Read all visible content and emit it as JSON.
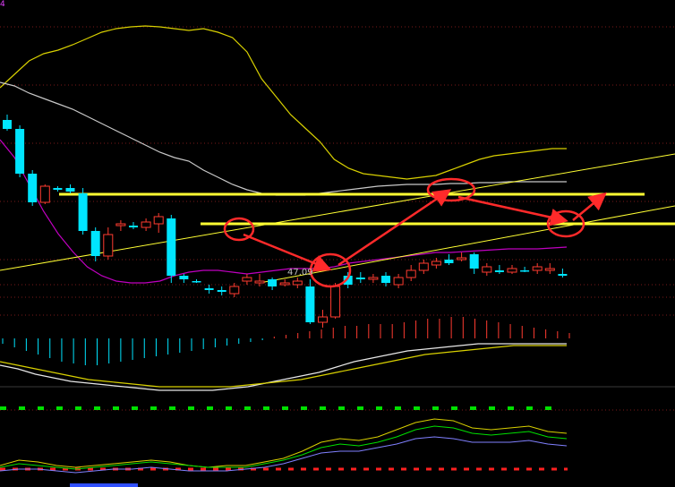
{
  "top_left_tag": "4",
  "colors": {
    "background": "#000000",
    "grid": "#7a1a1a",
    "bull": "#ff3b30",
    "bear": "#00e5ff",
    "upper_band": "#d8d000",
    "mid_band": "#c8c8c8",
    "lower_band": "#c000c0",
    "support_line": "#ffff33",
    "annotation": "#ff2a2a",
    "macd_fast": "#e8e8e8",
    "macd_slow": "#d8d000",
    "osc_green": "#00e000",
    "osc_red": "#ff2020",
    "osc_blue": "#8080ff"
  },
  "chart_data": {
    "type": "candlestick",
    "note_label": "47.09",
    "candles": [
      {
        "o": 24,
        "c": 34,
        "h": 18,
        "l": 36,
        "bull": false
      },
      {
        "o": 34,
        "c": 84,
        "h": 30,
        "l": 88,
        "bull": false
      },
      {
        "o": 84,
        "c": 116,
        "h": 80,
        "l": 120,
        "bull": false
      },
      {
        "o": 116,
        "c": 98,
        "h": 96,
        "l": 118,
        "bull": true
      },
      {
        "o": 100,
        "c": 102,
        "h": 98,
        "l": 104,
        "bull": false
      },
      {
        "o": 100,
        "c": 104,
        "h": 96,
        "l": 106,
        "bull": false
      },
      {
        "o": 106,
        "c": 148,
        "h": 100,
        "l": 152,
        "bull": false
      },
      {
        "o": 148,
        "c": 176,
        "h": 144,
        "l": 182,
        "bull": false
      },
      {
        "o": 176,
        "c": 152,
        "h": 144,
        "l": 180,
        "bull": true
      },
      {
        "o": 142,
        "c": 140,
        "h": 136,
        "l": 148,
        "bull": true
      },
      {
        "o": 142,
        "c": 144,
        "h": 138,
        "l": 146,
        "bull": false
      },
      {
        "o": 144,
        "c": 138,
        "h": 134,
        "l": 148,
        "bull": true
      },
      {
        "o": 140,
        "c": 132,
        "h": 128,
        "l": 150,
        "bull": true
      },
      {
        "o": 134,
        "c": 198,
        "h": 130,
        "l": 206,
        "bull": false
      },
      {
        "o": 198,
        "c": 202,
        "h": 196,
        "l": 206,
        "bull": false
      },
      {
        "o": 204,
        "c": 204,
        "h": 202,
        "l": 206,
        "bull": false
      },
      {
        "o": 212,
        "c": 214,
        "h": 208,
        "l": 218,
        "bull": false
      },
      {
        "o": 214,
        "c": 216,
        "h": 210,
        "l": 220,
        "bull": false
      },
      {
        "o": 218,
        "c": 210,
        "h": 206,
        "l": 222,
        "bull": true
      },
      {
        "o": 204,
        "c": 200,
        "h": 196,
        "l": 208,
        "bull": true
      },
      {
        "o": 206,
        "c": 204,
        "h": 196,
        "l": 210,
        "bull": true
      },
      {
        "o": 202,
        "c": 210,
        "h": 200,
        "l": 214,
        "bull": false
      },
      {
        "o": 206,
        "c": 208,
        "h": 202,
        "l": 210,
        "bull": true
      },
      {
        "o": 208,
        "c": 204,
        "h": 200,
        "l": 212,
        "bull": true
      },
      {
        "o": 210,
        "c": 250,
        "h": 202,
        "l": 252,
        "bull": false
      },
      {
        "o": 250,
        "c": 244,
        "h": 236,
        "l": 256,
        "bull": true
      },
      {
        "o": 244,
        "c": 210,
        "h": 206,
        "l": 246,
        "bull": true
      },
      {
        "o": 208,
        "c": 198,
        "h": 194,
        "l": 212,
        "bull": false
      },
      {
        "o": 200,
        "c": 202,
        "h": 194,
        "l": 206,
        "bull": false
      },
      {
        "o": 202,
        "c": 200,
        "h": 196,
        "l": 206,
        "bull": true
      },
      {
        "o": 206,
        "c": 198,
        "h": 194,
        "l": 210,
        "bull": false
      },
      {
        "o": 208,
        "c": 200,
        "h": 196,
        "l": 212,
        "bull": true
      },
      {
        "o": 200,
        "c": 192,
        "h": 186,
        "l": 204,
        "bull": true
      },
      {
        "o": 192,
        "c": 184,
        "h": 180,
        "l": 196,
        "bull": true
      },
      {
        "o": 186,
        "c": 182,
        "h": 178,
        "l": 190,
        "bull": true
      },
      {
        "o": 184,
        "c": 180,
        "h": 174,
        "l": 186,
        "bull": false
      },
      {
        "o": 180,
        "c": 178,
        "h": 172,
        "l": 182,
        "bull": true
      },
      {
        "o": 174,
        "c": 190,
        "h": 172,
        "l": 196,
        "bull": false
      },
      {
        "o": 194,
        "c": 188,
        "h": 184,
        "l": 198,
        "bull": true
      },
      {
        "o": 192,
        "c": 194,
        "h": 186,
        "l": 196,
        "bull": false
      },
      {
        "o": 194,
        "c": 190,
        "h": 186,
        "l": 196,
        "bull": true
      },
      {
        "o": 192,
        "c": 192,
        "h": 188,
        "l": 194,
        "bull": false
      },
      {
        "o": 192,
        "c": 188,
        "h": 184,
        "l": 196,
        "bull": true
      },
      {
        "o": 190,
        "c": 192,
        "h": 184,
        "l": 196,
        "bull": true
      },
      {
        "o": 196,
        "c": 198,
        "h": 190,
        "l": 200,
        "bull": false
      }
    ],
    "upper_band": [
      70,
      55,
      40,
      32,
      28,
      22,
      15,
      8,
      4,
      2,
      1,
      2,
      4,
      6,
      4,
      8,
      14,
      30,
      60,
      80,
      100,
      115,
      130,
      150,
      160,
      166,
      168,
      170,
      172,
      170,
      168,
      162,
      156,
      150,
      146,
      144,
      142,
      140,
      138,
      138
    ],
    "mid_band": [
      92,
      96,
      104,
      110,
      116,
      122,
      130,
      138,
      146,
      154,
      162,
      170,
      176,
      180,
      190,
      198,
      206,
      212,
      216,
      218,
      218,
      218,
      216,
      214,
      212,
      210,
      208,
      207,
      206,
      206,
      206,
      205,
      205,
      204,
      204,
      203,
      203,
      203,
      203,
      203
    ],
    "lower_band": [
      110,
      130,
      160,
      190,
      215,
      235,
      252,
      262,
      268,
      270,
      270,
      268,
      262,
      258,
      256,
      256,
      258,
      260,
      258,
      256,
      254,
      254,
      254,
      252,
      248,
      246,
      244,
      242,
      240,
      238,
      236,
      236,
      235,
      234,
      233,
      232,
      232,
      232,
      231,
      230
    ],
    "macd_bars": [
      -6,
      -10,
      -14,
      -18,
      -22,
      -26,
      -28,
      -30,
      -30,
      -28,
      -26,
      -24,
      -22,
      -20,
      -18,
      -16,
      -14,
      -12,
      -10,
      -8,
      -6,
      -4,
      -2,
      2,
      4,
      6,
      8,
      10,
      12,
      14,
      14,
      16,
      16,
      16,
      18,
      20,
      22,
      22,
      24,
      24,
      22,
      20,
      18,
      16,
      14,
      12,
      10,
      8,
      6
    ],
    "macd_fast": [
      10,
      14,
      20,
      24,
      28,
      30,
      32,
      34,
      36,
      38,
      38,
      38,
      38,
      36,
      34,
      30,
      26,
      22,
      18,
      12,
      6,
      2,
      -2,
      -6,
      -8,
      -10,
      -12,
      -14,
      -14,
      -14,
      -14,
      -14,
      -14
    ],
    "macd_slow": [
      6,
      10,
      14,
      18,
      22,
      26,
      28,
      30,
      32,
      34,
      34,
      34,
      34,
      34,
      32,
      30,
      28,
      26,
      22,
      18,
      14,
      10,
      6,
      2,
      -2,
      -4,
      -6,
      -8,
      -10,
      -12,
      -12,
      -12,
      -12
    ],
    "osc_line1": [
      520,
      514,
      516,
      520,
      522,
      520,
      518,
      516,
      514,
      516,
      520,
      522,
      520,
      520,
      516,
      512,
      504,
      494,
      490,
      492,
      488,
      480,
      472,
      468,
      470,
      478,
      480,
      478,
      476,
      482,
      484
    ],
    "osc_line2": [
      522,
      518,
      520,
      522,
      524,
      522,
      520,
      518,
      516,
      518,
      520,
      522,
      522,
      522,
      518,
      514,
      508,
      500,
      496,
      498,
      494,
      488,
      480,
      476,
      478,
      484,
      486,
      484,
      482,
      488,
      490
    ],
    "osc_line3": [
      526,
      524,
      524,
      526,
      528,
      526,
      524,
      524,
      522,
      524,
      526,
      526,
      526,
      524,
      522,
      518,
      512,
      506,
      504,
      504,
      500,
      496,
      490,
      488,
      490,
      494,
      494,
      494,
      492,
      496,
      498
    ]
  }
}
